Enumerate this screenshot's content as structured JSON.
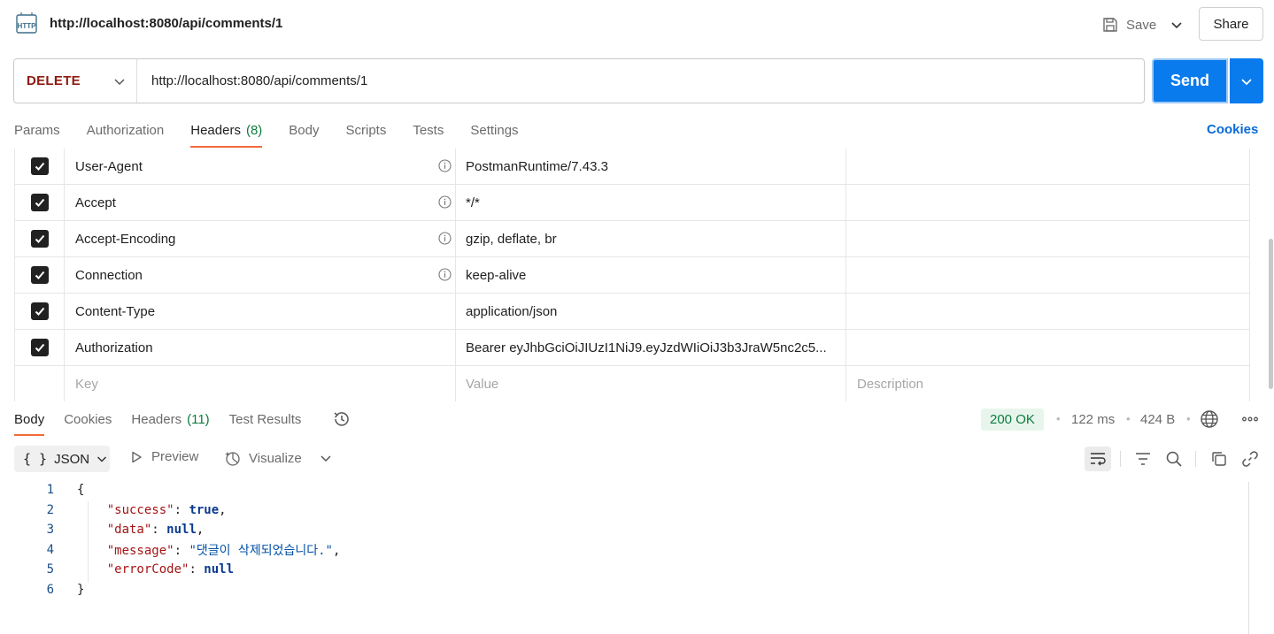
{
  "header": {
    "request_title": "http://localhost:8080/api/comments/1",
    "save_label": "Save",
    "share_label": "Share"
  },
  "request": {
    "method": "DELETE",
    "url": "http://localhost:8080/api/comments/1",
    "send_label": "Send"
  },
  "request_tabs": {
    "params": "Params",
    "authorization": "Authorization",
    "headers": "Headers",
    "headers_count": "(8)",
    "body": "Body",
    "scripts": "Scripts",
    "tests": "Tests",
    "settings": "Settings",
    "cookies": "Cookies"
  },
  "headers_table": {
    "rows": [
      {
        "key": "User-Agent",
        "value": "PostmanRuntime/7.43.3",
        "description": "",
        "checked": true
      },
      {
        "key": "Accept",
        "value": "*/*",
        "description": "",
        "checked": true
      },
      {
        "key": "Accept-Encoding",
        "value": "gzip, deflate, br",
        "description": "",
        "checked": true
      },
      {
        "key": "Connection",
        "value": "keep-alive",
        "description": "",
        "checked": true
      },
      {
        "key": "Content-Type",
        "value": "application/json",
        "description": "",
        "checked": true
      },
      {
        "key": "Authorization",
        "value": "Bearer eyJhbGciOiJIUzI1NiJ9.eyJzdWIiOiJ3b3JraW5nc2c5...",
        "description": "",
        "checked": true
      }
    ],
    "new_row": {
      "key_placeholder": "Key",
      "value_placeholder": "Value",
      "description_placeholder": "Description"
    }
  },
  "response": {
    "tabs": {
      "body": "Body",
      "cookies": "Cookies",
      "headers": "Headers",
      "headers_count": "(11)",
      "test_results": "Test Results"
    },
    "status": "200 OK",
    "time": "122 ms",
    "size": "424 B",
    "format_braces": "{ }",
    "format": "JSON",
    "preview": "Preview",
    "visualize": "Visualize",
    "code_lines": [
      {
        "n": "1",
        "text": "{"
      },
      {
        "n": "2",
        "text": "    \"success\": true,"
      },
      {
        "n": "3",
        "text": "    \"data\": null,"
      },
      {
        "n": "4",
        "text": "    \"message\": \"댓글이 삭제되었습니다.\","
      },
      {
        "n": "5",
        "text": "    \"errorCode\": null"
      },
      {
        "n": "6",
        "text": "}"
      }
    ]
  },
  "colors": {
    "accent_blue": "#097bed",
    "method_delete": "#8e1a10",
    "tab_underline": "#f26b3a",
    "status_green": "#0b7d3e"
  }
}
